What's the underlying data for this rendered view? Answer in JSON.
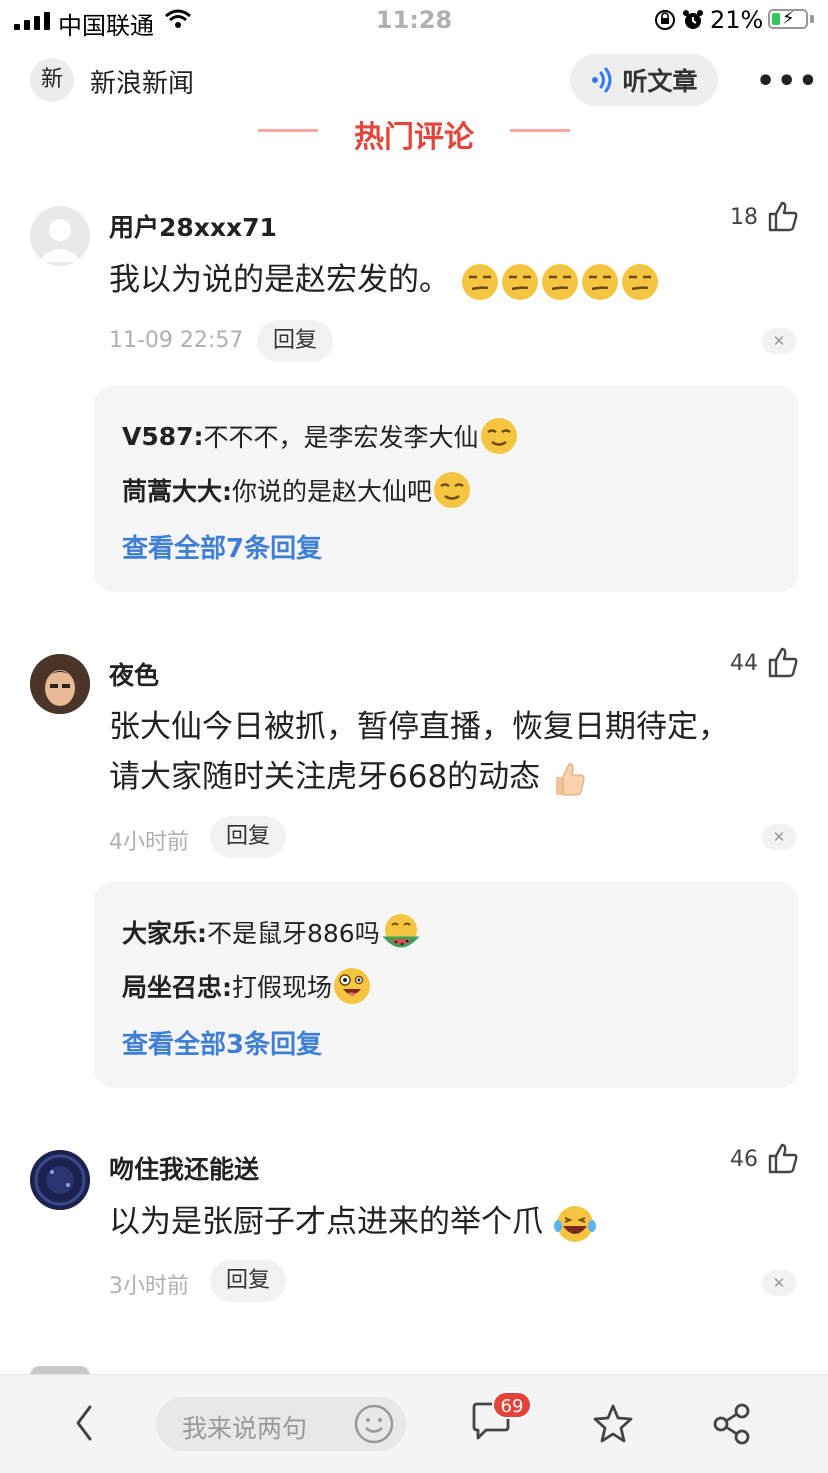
{
  "status_bar": {
    "carrier": "中国联通",
    "time": "11:28",
    "battery": "21%"
  },
  "header": {
    "logo_char": "新",
    "app_name": "新浪新闻",
    "listen_label": "听文章",
    "more_label": "•••"
  },
  "section": {
    "title": "热门评论"
  },
  "comments": [
    {
      "user": "用户28xxx71",
      "likes": "18",
      "text": "我以为说的是赵宏发的。",
      "time": "11-09 22:57",
      "reply_label": "回复",
      "replies": [
        {
          "user": "V587:",
          "text": " 不不不，是李宏发李大仙"
        },
        {
          "user": "茼蒿大大:",
          "text": " 你说的是赵大仙吧"
        }
      ],
      "view_all": "查看全部7条回复"
    },
    {
      "user": "夜色",
      "likes": "44",
      "text_line1": "张大仙今日被抓，暂停直播，恢复日期待定，",
      "text_line2": "请大家随时关注虎牙668的动态",
      "time": "4小时前",
      "reply_label": "回复",
      "replies": [
        {
          "user": "大家乐:",
          "text": " 不是鼠牙886吗"
        },
        {
          "user": "局坐召忠:",
          "text": " 打假现场"
        }
      ],
      "view_all": "查看全部3条回复"
    },
    {
      "user": "吻住我还能送",
      "likes": "46",
      "text": "以为是张厨子才点进来的举个爪",
      "time": "3小时前",
      "reply_label": "回复"
    }
  ],
  "bottom_bar": {
    "input_placeholder": "我来说两句",
    "comment_count": "69"
  },
  "icons": [
    "signal-icon",
    "wifi-icon",
    "lock-rotation-icon",
    "alarm-icon",
    "battery-icon",
    "audio-wave-icon",
    "more-icon",
    "thumb-up-icon",
    "close-icon",
    "back-icon",
    "smile-icon",
    "comment-icon",
    "star-icon",
    "share-icon"
  ],
  "colors": {
    "accent_red": "#e4443a",
    "link_blue": "#3f7fd6",
    "reply_bg": "#f6f6f6"
  }
}
